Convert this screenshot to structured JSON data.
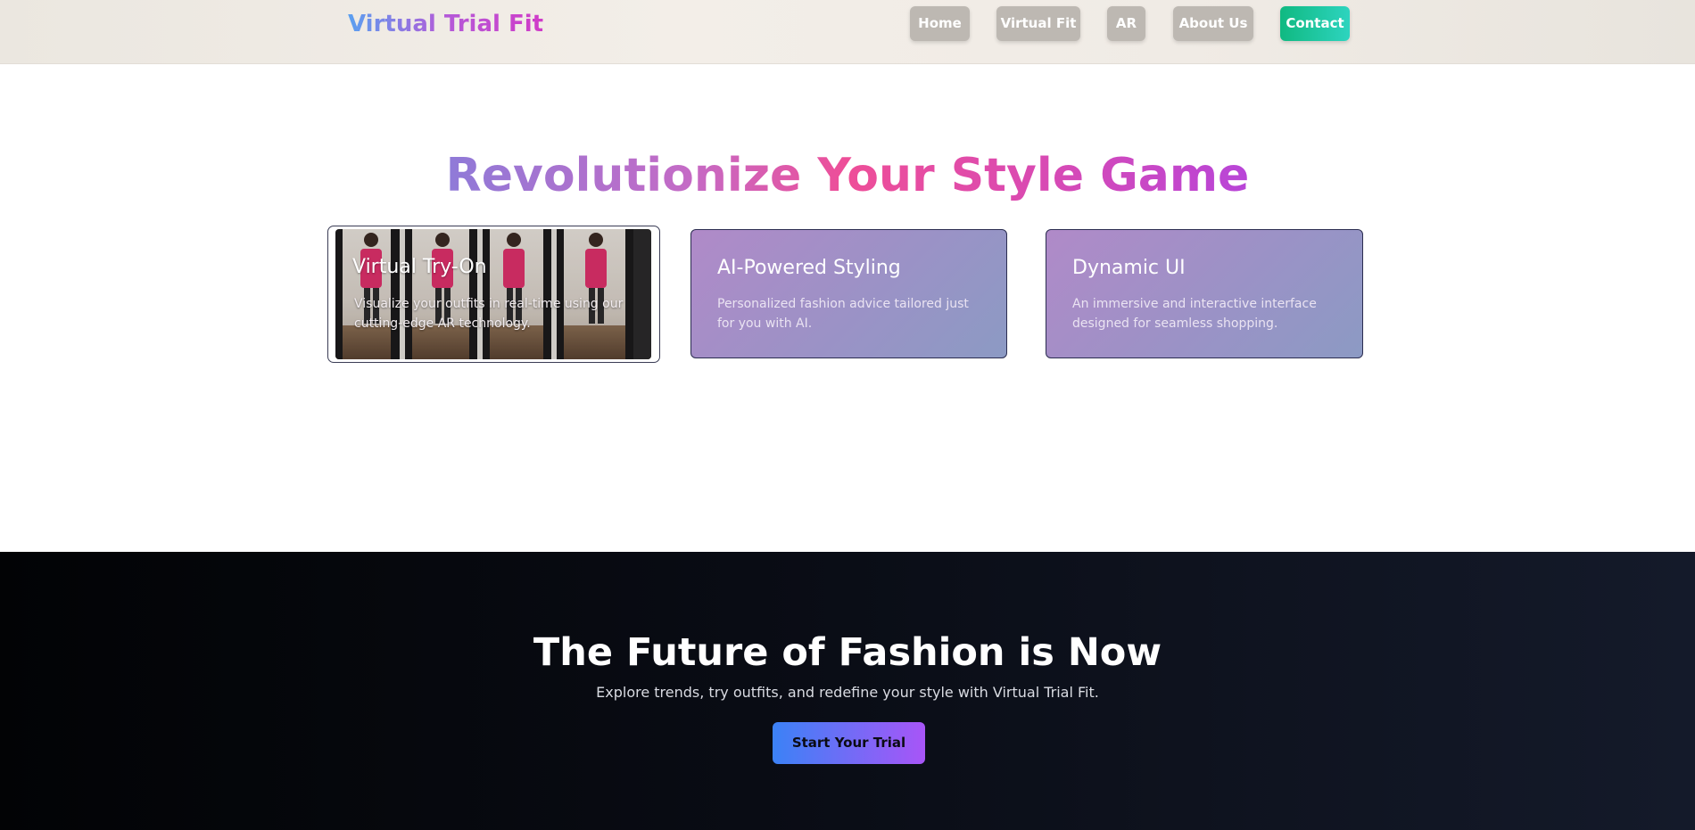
{
  "header": {
    "logo": "Virtual Trial Fit",
    "nav": {
      "home": "Home",
      "virtual_fit": "Virtual Fit",
      "ar": "AR",
      "about": "About Us",
      "contact": "Contact"
    }
  },
  "features": {
    "title": "Revolutionize Your Style Game",
    "cards": [
      {
        "title": "Virtual Try-On",
        "description": "Visualize your outfits in real-time using our cutting-edge AR technology."
      },
      {
        "title": "AI-Powered Styling",
        "description": "Personalized fashion advice tailored just for you with AI."
      },
      {
        "title": "Dynamic UI",
        "description": "An immersive and interactive interface designed for seamless shopping."
      }
    ]
  },
  "cta": {
    "title": "The Future of Fashion is Now",
    "subtitle": "Explore trends, try outfits, and redefine your style with Virtual Trial Fit.",
    "button": "Start Your Trial"
  },
  "colors": {
    "accent_contact": "#10b981",
    "card_gradient_start": "#b08ac8",
    "card_gradient_end": "#8c9ac4",
    "cta_button_start": "#3b82f6",
    "cta_button_end": "#a855f7"
  },
  "icons": {
    "card_image": "mirror-outfit-photo"
  }
}
